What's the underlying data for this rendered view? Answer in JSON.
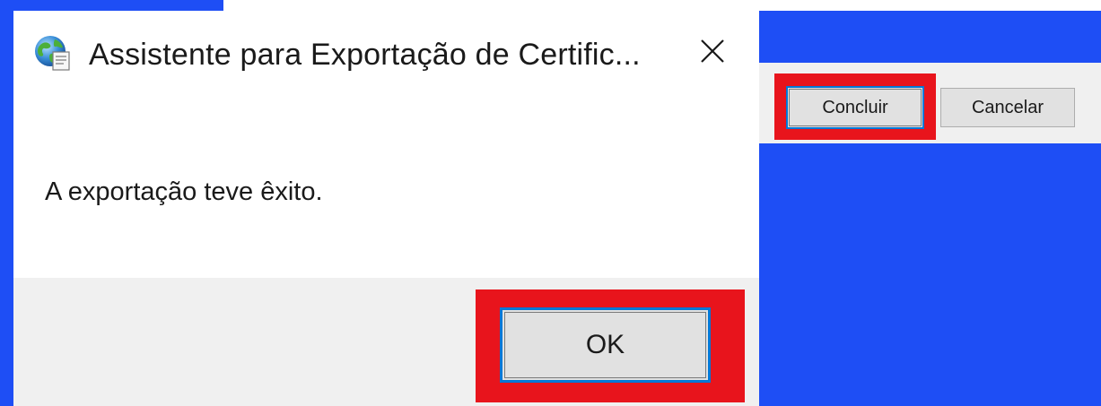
{
  "dialog": {
    "title": "Assistente para Exportação de Certific...",
    "title_icon": "certificate-globe-icon",
    "close_icon": "close-icon",
    "message": "A exportação teve êxito.",
    "ok_label": "OK"
  },
  "inset_panel": {
    "finish_label": "Concluir",
    "cancel_label": "Cancelar"
  },
  "colors": {
    "background": "#1e4ef5",
    "highlight": "#e8141c",
    "button_focus_border": "#0078d7",
    "button_face": "#e1e1e1",
    "footer": "#f0f0f0"
  }
}
